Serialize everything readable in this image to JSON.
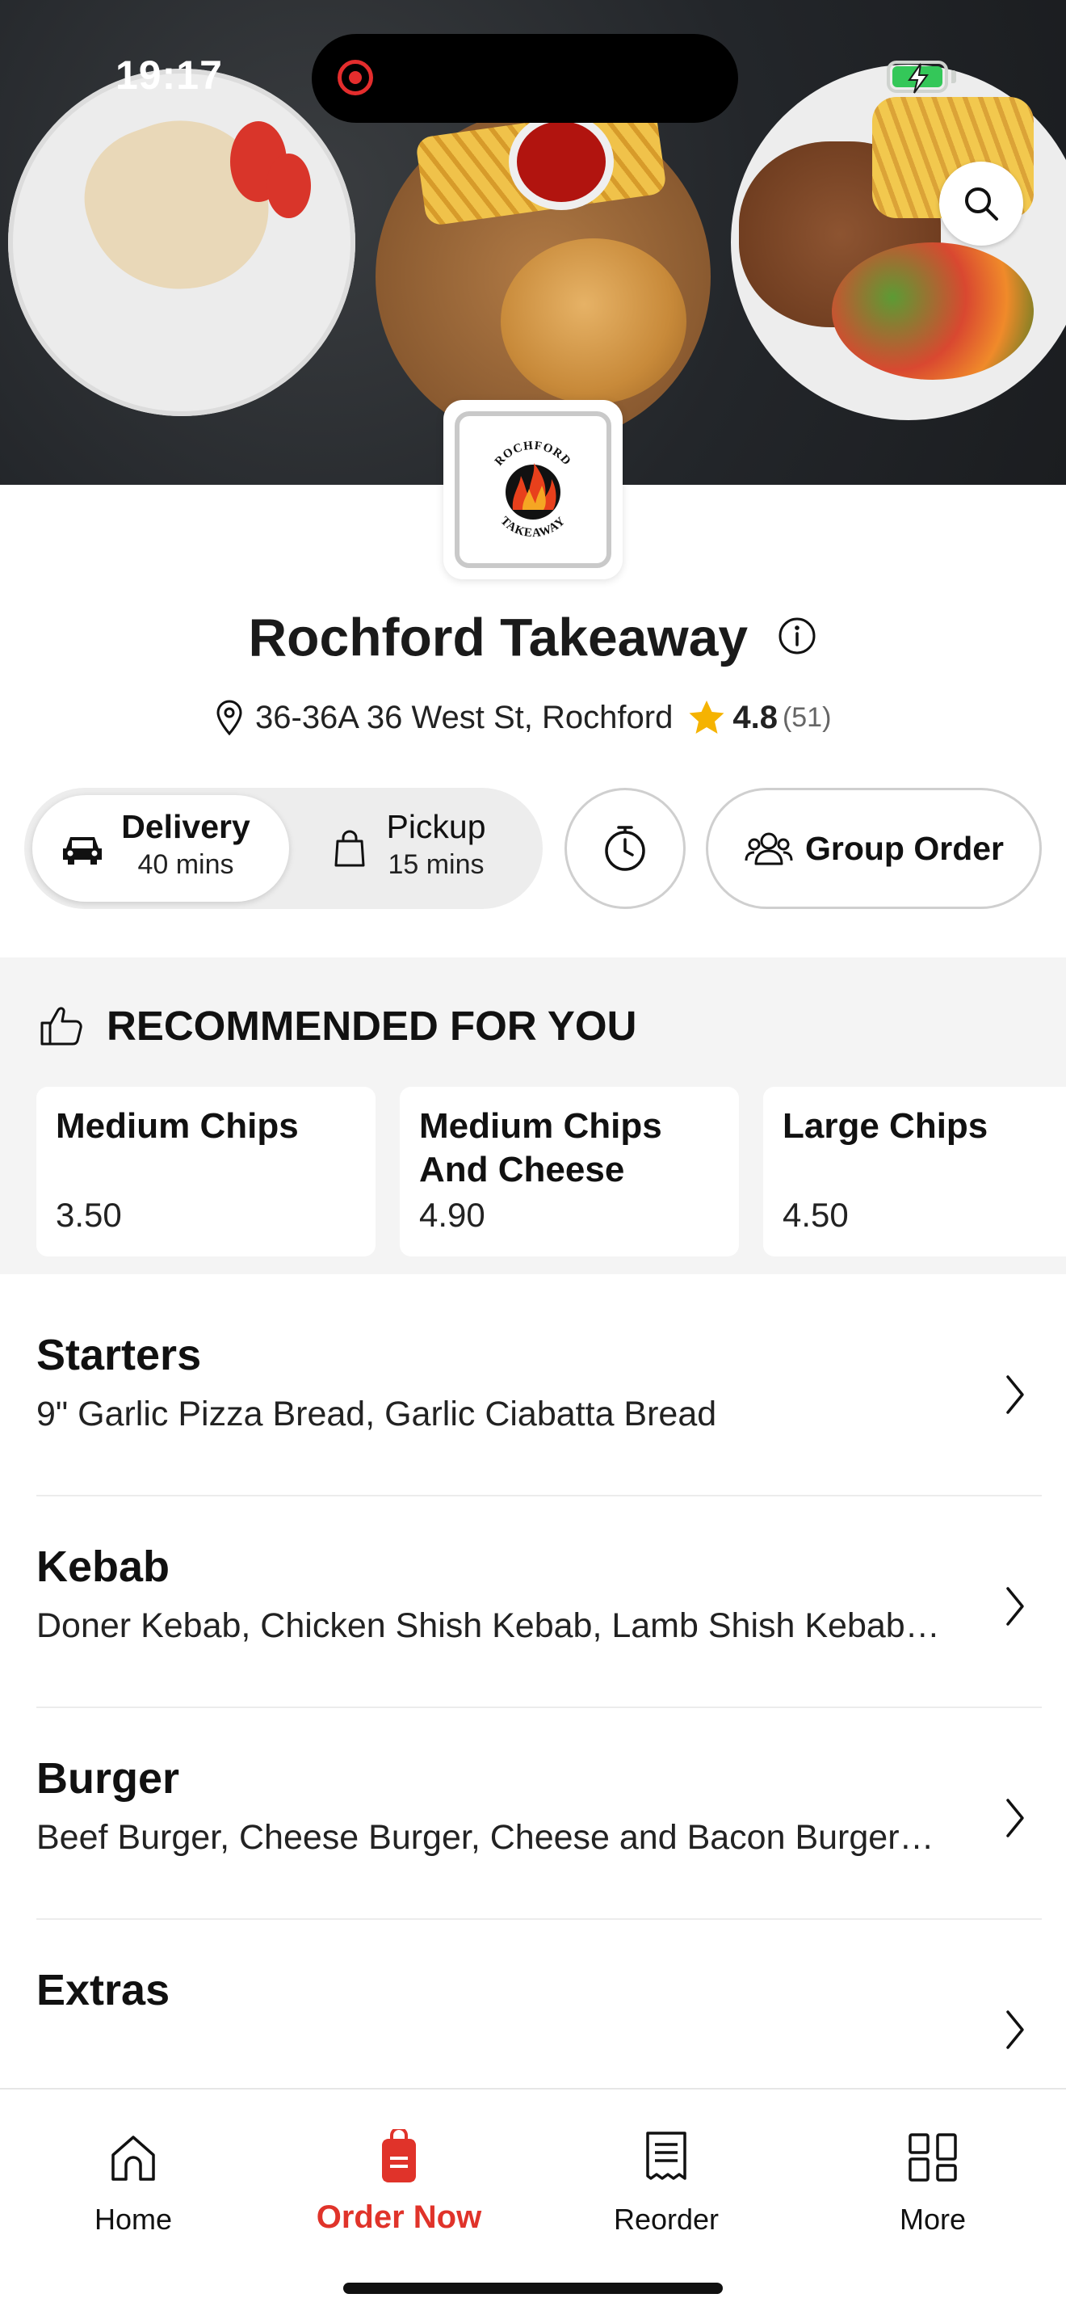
{
  "status_bar": {
    "time": "19:17"
  },
  "restaurant": {
    "name": "Rochford Takeaway",
    "address": "36-36A 36 West St, Rochford",
    "rating": "4.8",
    "rating_count": "(51)",
    "logo_text_top": "ROCHFORD",
    "logo_text_bottom": "TAKEAWAY"
  },
  "order_modes": {
    "delivery": {
      "label": "Delivery",
      "time": "40 mins"
    },
    "pickup": {
      "label": "Pickup",
      "time": "15 mins"
    },
    "group_order_label": "Group Order",
    "selected": "delivery"
  },
  "recommended": {
    "title": "RECOMMENDED FOR YOU",
    "items": [
      {
        "name": "Medium Chips",
        "price": "3.50"
      },
      {
        "name": "Medium Chips And Cheese",
        "price": "4.90"
      },
      {
        "name": "Large Chips",
        "price": "4.50"
      }
    ]
  },
  "categories": [
    {
      "name": "Starters",
      "items": "9\" Garlic Pizza Bread, Garlic Ciabatta Bread"
    },
    {
      "name": "Kebab",
      "items": "Doner Kebab, Chicken Shish Kebab, Lamb Shish Kebab…"
    },
    {
      "name": "Burger",
      "items": "Beef Burger, Cheese Burger, Cheese and Bacon Burger…"
    },
    {
      "name": "Extras",
      "items": ""
    }
  ],
  "tab_bar": {
    "items": [
      {
        "label": "Home",
        "icon": "home-icon"
      },
      {
        "label": "Order Now",
        "icon": "order-bag-icon"
      },
      {
        "label": "Reorder",
        "icon": "receipt-icon"
      },
      {
        "label": "More",
        "icon": "grid-icon"
      }
    ],
    "active_index": 1
  },
  "colors": {
    "accent": "#e0332a",
    "star": "#f5b301",
    "battery": "#34c759"
  }
}
